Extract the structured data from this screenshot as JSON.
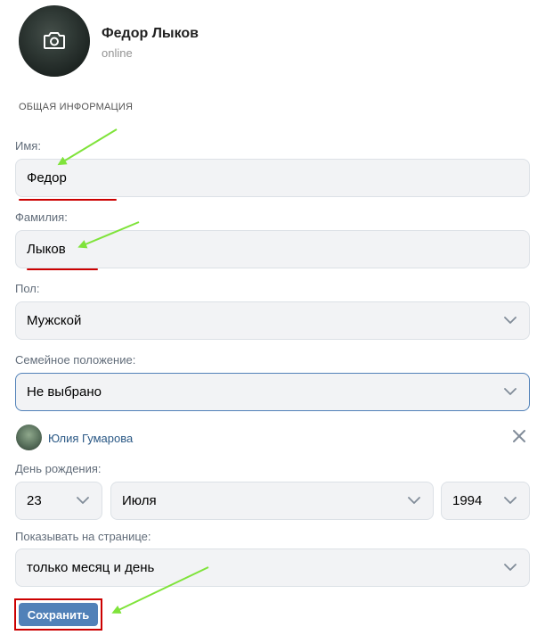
{
  "profile": {
    "name": "Федор Лыков",
    "status": "online"
  },
  "section_title": "ОБЩАЯ ИНФОРМАЦИЯ",
  "form": {
    "first_name": {
      "label": "Имя:",
      "value": "Федор"
    },
    "last_name": {
      "label": "Фамилия:",
      "value": "Лыков"
    },
    "gender": {
      "label": "Пол:",
      "value": "Мужской"
    },
    "marital": {
      "label": "Семейное положение:",
      "value": "Не выбрано"
    },
    "partner": {
      "name": "Юлия Гумарова"
    },
    "birthday": {
      "label": "День рождения:",
      "day": "23",
      "month": "Июля",
      "year": "1994"
    },
    "show_on_page": {
      "label": "Показывать на странице:",
      "value": "только месяц и день"
    },
    "save_label": "Сохранить"
  },
  "colors": {
    "accent": "#5181b8",
    "annotation_arrow": "#7fe33a",
    "annotation_mark": "#cc0000"
  },
  "icons": {
    "avatar_overlay": "camera-icon",
    "dropdown": "chevron-down-icon",
    "remove": "close-icon"
  }
}
